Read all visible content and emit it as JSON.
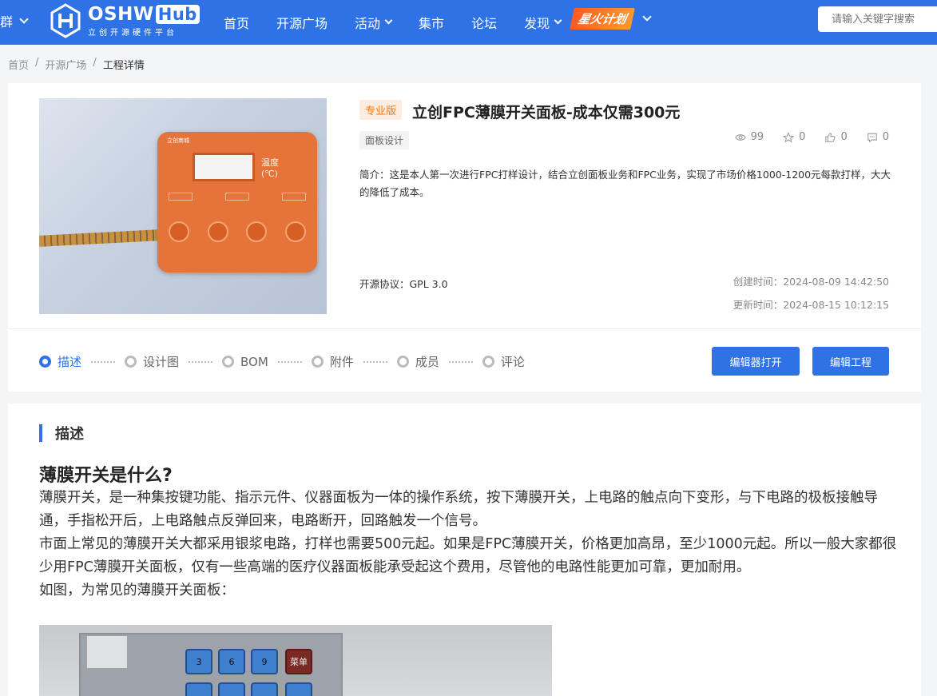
{
  "header": {
    "group_label": "群",
    "logo_main": "OSHW",
    "logo_hub": "Hub",
    "logo_sub": "立创开源硬件平台",
    "nav": [
      {
        "label": "首页",
        "has_dropdown": false
      },
      {
        "label": "开源广场",
        "has_dropdown": false
      },
      {
        "label": "活动",
        "has_dropdown": true
      },
      {
        "label": "集市",
        "has_dropdown": false
      },
      {
        "label": "论坛",
        "has_dropdown": false
      },
      {
        "label": "发现",
        "has_dropdown": true
      }
    ],
    "spark_label": "星火计划",
    "search_placeholder": "请输入关键字搜索",
    "accent_color": "#2e72e6"
  },
  "breadcrumb": [
    "首页",
    "开源广场",
    "工程详情"
  ],
  "project": {
    "edition_badge": "专业版",
    "title": "立创FPC薄膜开关面板-成本仅需300元",
    "tag": "面板设计",
    "stats": {
      "views": "99",
      "stars": "0",
      "likes": "0",
      "comments": "0"
    },
    "intro": "简介：这是本人第一次进行FPC打样设计，结合立创面板业务和FPC业务，实现了市场价格1000-1200元每款打样，大大的降低了成本。",
    "license": "开源协议：GPL 3.0",
    "created": "创建时间：2024-08-09 14:42:50",
    "updated": "更新时间：2024-08-15 10:12:15",
    "steps": [
      "描述",
      "设计图",
      "BOM",
      "附件",
      "成员",
      "评论"
    ],
    "active_step": "描述",
    "btn_open_editor": "编辑器打开",
    "btn_edit_project": "编辑工程",
    "cover_panel_text": {
      "brand": "立创商城",
      "temp": "温度",
      "unit": "(℃)"
    }
  },
  "description": {
    "section_title": "描述",
    "heading": "薄膜开关是什么?",
    "paragraphs": [
      "薄膜开关，是一种集按键功能、指示元件、仪器面板为一体的操作系统，按下薄膜开关，上电路的触点向下变形，与下电路的极板接触导通，手指松开后，上电路触点反弹回来，电路断开，回路触发一个信号。",
      "市面上常见的薄膜开关大都采用银浆电路，打样也需要500元起。如果是FPC薄膜开关，价格更加高昂，至少1000元起。所以一般大家都很少用FPC薄膜开关面板，仅有一些高端的医疗仪器面板能承受起这个费用，尽管他的电路性能更加可靠，更加耐用。",
      "如图，为常见的薄膜开关面板："
    ],
    "photo_keys": [
      "3",
      "6",
      "9",
      "菜单"
    ]
  }
}
